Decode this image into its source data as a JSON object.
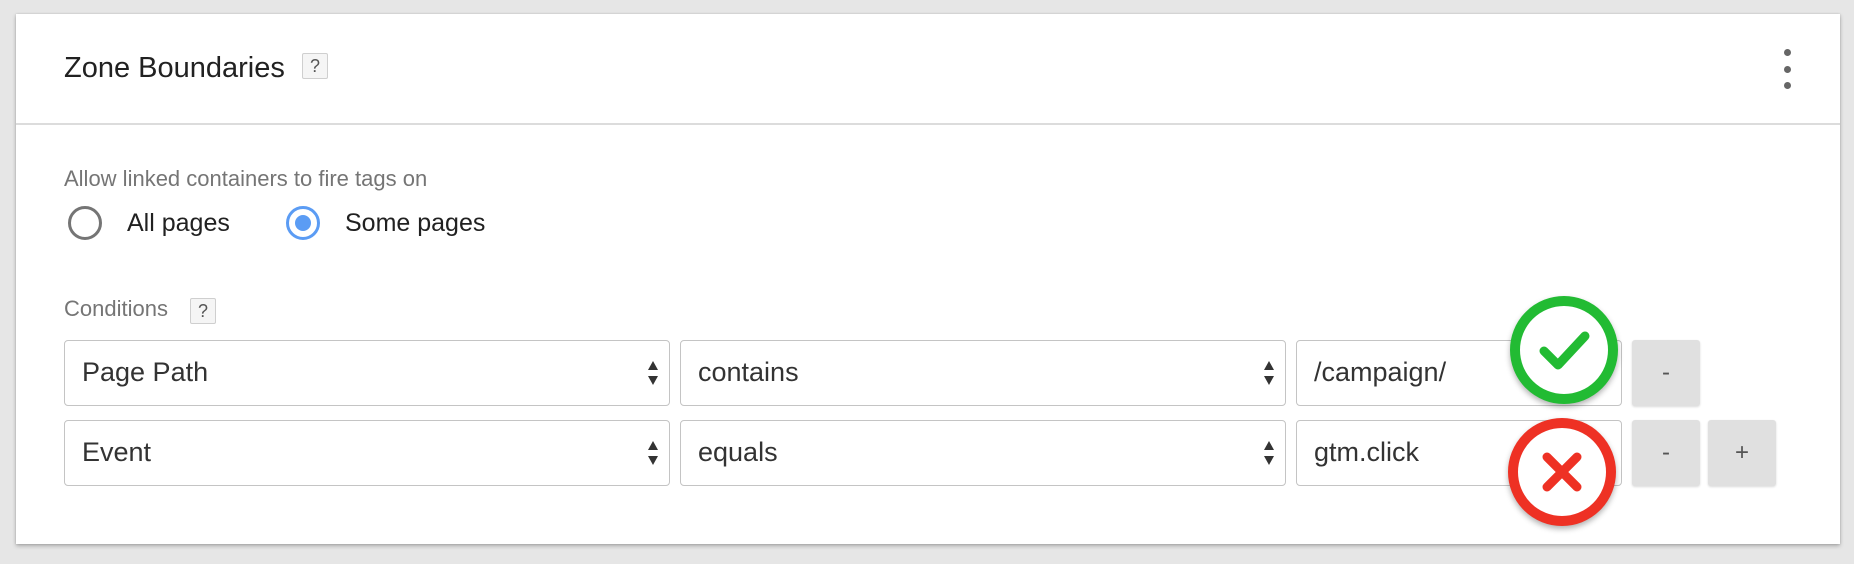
{
  "panel": {
    "title": "Zone Boundaries",
    "help": "?",
    "menu_icon": "more-vert-icon"
  },
  "fire_tags": {
    "label": "Allow linked containers to fire tags on",
    "options": [
      {
        "label": "All pages",
        "selected": false
      },
      {
        "label": "Some pages",
        "selected": true
      }
    ]
  },
  "conditions": {
    "label": "Conditions",
    "help": "?",
    "rows": [
      {
        "variable": "Page Path",
        "operator": "contains",
        "value": "/campaign/",
        "status": "valid",
        "status_icon": "check-icon"
      },
      {
        "variable": "Event",
        "operator": "equals",
        "value": "gtm.click",
        "status": "invalid",
        "status_icon": "close-icon"
      }
    ],
    "remove_label": "-",
    "add_label": "+"
  },
  "colors": {
    "radio_selected": "#5b9cf4",
    "valid": "#22bb33",
    "invalid": "#ee3124"
  }
}
